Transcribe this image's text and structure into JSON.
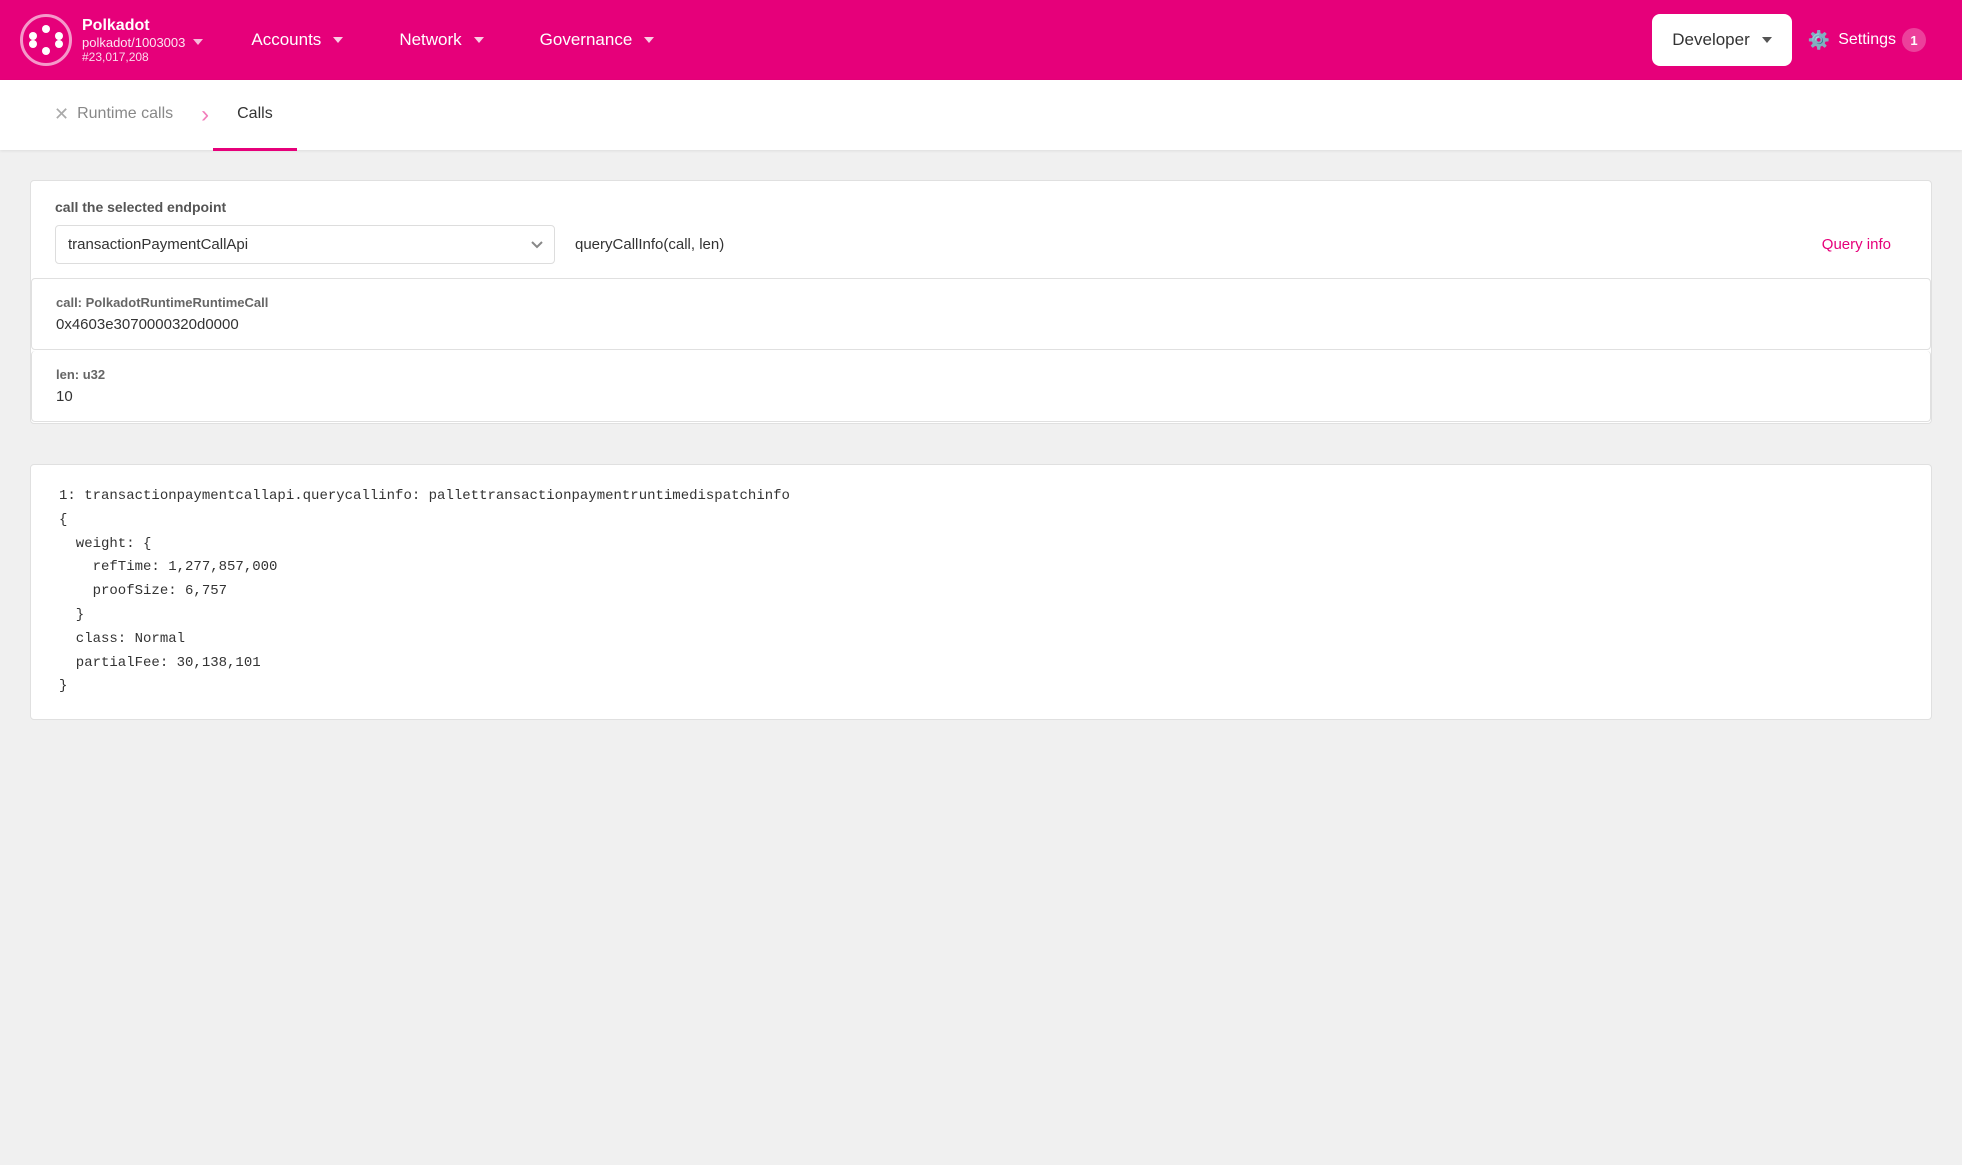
{
  "header": {
    "brand": {
      "name": "Polkadot",
      "network": "polkadot/1003003",
      "block": "#23,017,208"
    },
    "nav": {
      "accounts": "Accounts",
      "network": "Network",
      "governance": "Governance",
      "developer": "Developer",
      "settings": "Settings",
      "settings_badge": "1"
    }
  },
  "tabs": {
    "runtime_calls": "Runtime calls",
    "calls": "Calls"
  },
  "endpoint": {
    "label": "call the selected endpoint",
    "api": "transactionPaymentCallApi",
    "method": "queryCallInfo(call, len)",
    "query_button": "Query info"
  },
  "params": {
    "call_label": "call: PolkadotRuntimeRuntimeCall",
    "call_value": "0x4603e3070000320d0000",
    "len_label": "len: u32",
    "len_value": "10"
  },
  "result": {
    "line1": "1: transactionpaymentcallapi.querycallinfo: pallettransactionpaymentruntimedispatchinfo",
    "line2": "{",
    "line3": "  weight: {",
    "line4": "    refTime: 1,277,857,000",
    "line5": "    proofSize: 6,757",
    "line6": "  }",
    "line7": "  class: Normal",
    "line8": "  partialFee: 30,138,101",
    "line9": "}"
  }
}
